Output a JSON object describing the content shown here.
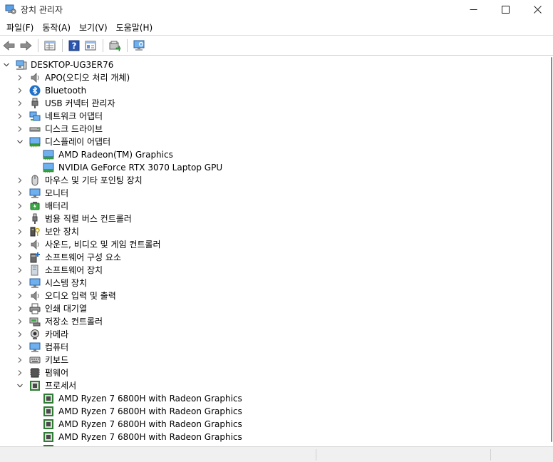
{
  "window": {
    "title": "장치 관리자",
    "app_icon": "device-manager-icon",
    "controls": [
      "minimize-icon",
      "maximize-icon",
      "close-icon"
    ]
  },
  "menu": [
    "파일(F)",
    "동작(A)",
    "보기(V)",
    "도움말(H)"
  ],
  "toolbar": [
    "back-arrow-icon",
    "forward-arrow-icon",
    "properties-icon",
    "help-icon",
    "details-view-icon",
    "update-driver-icon",
    "scan-hardware-icon"
  ],
  "tree": [
    {
      "level": 0,
      "expander": "expanded",
      "icon": "computer-icon",
      "label": "DESKTOP-UG3ER76"
    },
    {
      "level": 1,
      "expander": "collapsed",
      "icon": "speaker-icon",
      "label": "APO(오디오 처리 개체)"
    },
    {
      "level": 1,
      "expander": "collapsed",
      "icon": "bluetooth-icon",
      "label": "Bluetooth"
    },
    {
      "level": 1,
      "expander": "collapsed",
      "icon": "usb-plug-icon",
      "label": "USB 커넥터 관리자"
    },
    {
      "level": 1,
      "expander": "collapsed",
      "icon": "network-icon",
      "label": "네트워크 어댑터"
    },
    {
      "level": 1,
      "expander": "collapsed",
      "icon": "disk-drive-icon",
      "label": "디스크 드라이브"
    },
    {
      "level": 1,
      "expander": "expanded",
      "icon": "display-adapter-icon",
      "label": "디스플레이 어댑터"
    },
    {
      "level": 2,
      "expander": "none",
      "icon": "display-adapter-icon",
      "label": "AMD Radeon(TM) Graphics"
    },
    {
      "level": 2,
      "expander": "none",
      "icon": "display-adapter-icon",
      "label": "NVIDIA GeForce RTX 3070 Laptop GPU"
    },
    {
      "level": 1,
      "expander": "collapsed",
      "icon": "mouse-icon",
      "label": "마우스 및 기타 포인팅 장치"
    },
    {
      "level": 1,
      "expander": "collapsed",
      "icon": "monitor-icon",
      "label": "모니터"
    },
    {
      "level": 1,
      "expander": "collapsed",
      "icon": "battery-icon",
      "label": "배터리"
    },
    {
      "level": 1,
      "expander": "collapsed",
      "icon": "usb-controller-icon",
      "label": "범용 직렬 버스 컨트롤러"
    },
    {
      "level": 1,
      "expander": "collapsed",
      "icon": "security-key-icon",
      "label": "보안 장치"
    },
    {
      "level": 1,
      "expander": "collapsed",
      "icon": "speaker-icon",
      "label": "사운드, 비디오 및 게임 컨트롤러"
    },
    {
      "level": 1,
      "expander": "collapsed",
      "icon": "software-component-icon",
      "label": "소프트웨어 구성 요소"
    },
    {
      "level": 1,
      "expander": "collapsed",
      "icon": "software-device-icon",
      "label": "소프트웨어 장치"
    },
    {
      "level": 1,
      "expander": "collapsed",
      "icon": "system-device-icon",
      "label": "시스템 장치"
    },
    {
      "level": 1,
      "expander": "collapsed",
      "icon": "speaker-icon",
      "label": "오디오 입력 및 출력"
    },
    {
      "level": 1,
      "expander": "collapsed",
      "icon": "printer-icon",
      "label": "인쇄 대기열"
    },
    {
      "level": 1,
      "expander": "collapsed",
      "icon": "storage-controller-icon",
      "label": "저장소 컨트롤러"
    },
    {
      "level": 1,
      "expander": "collapsed",
      "icon": "camera-icon",
      "label": "카메라"
    },
    {
      "level": 1,
      "expander": "collapsed",
      "icon": "computer-monitor-icon",
      "label": "컴퓨터"
    },
    {
      "level": 1,
      "expander": "collapsed",
      "icon": "keyboard-icon",
      "label": "키보드"
    },
    {
      "level": 1,
      "expander": "collapsed",
      "icon": "firmware-icon",
      "label": "펌웨어"
    },
    {
      "level": 1,
      "expander": "expanded",
      "icon": "processor-icon",
      "label": "프로세서"
    },
    {
      "level": 2,
      "expander": "none",
      "icon": "processor-icon",
      "label": "AMD Ryzen 7 6800H with Radeon Graphics"
    },
    {
      "level": 2,
      "expander": "none",
      "icon": "processor-icon",
      "label": "AMD Ryzen 7 6800H with Radeon Graphics"
    },
    {
      "level": 2,
      "expander": "none",
      "icon": "processor-icon",
      "label": "AMD Ryzen 7 6800H with Radeon Graphics"
    },
    {
      "level": 2,
      "expander": "none",
      "icon": "processor-icon",
      "label": "AMD Ryzen 7 6800H with Radeon Graphics"
    },
    {
      "level": 2,
      "expander": "none",
      "icon": "processor-icon",
      "label": ""
    }
  ],
  "colors": {
    "accent": "#1e70c8",
    "expander": "#555555",
    "processor_green": "#2e7d32"
  }
}
